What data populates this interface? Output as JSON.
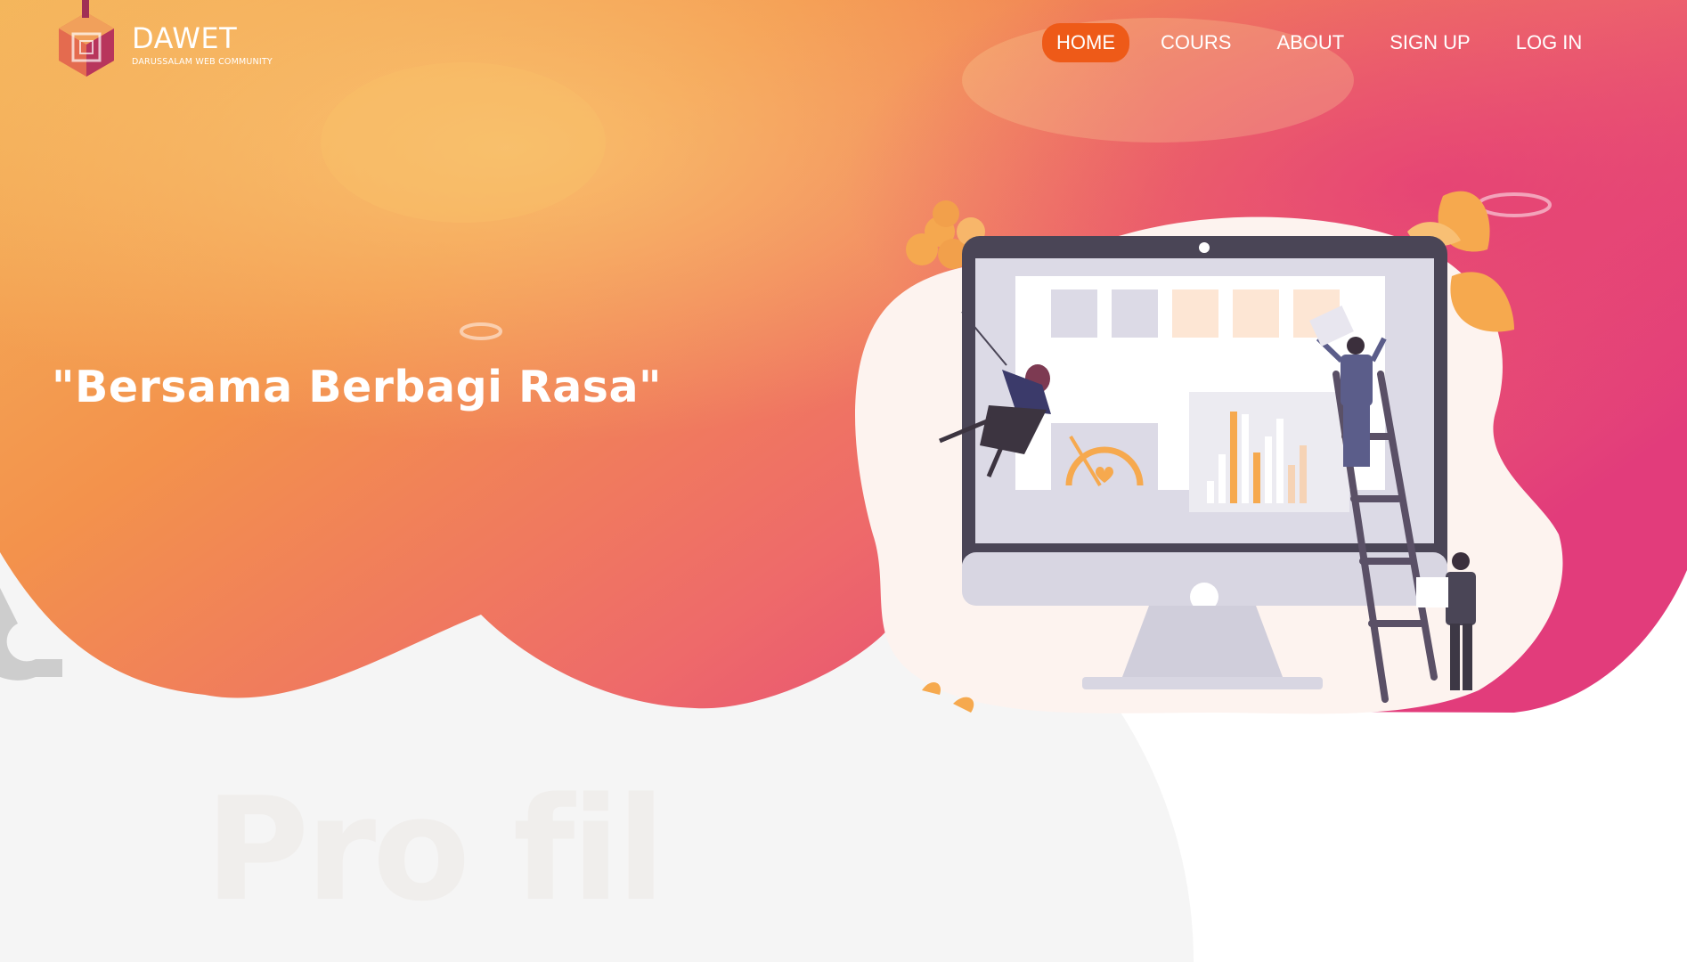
{
  "brand": {
    "name": "DAWET",
    "subtitle": "DARUSSALAM WEB COMMUNITY"
  },
  "nav": {
    "items": [
      {
        "label": "HOME",
        "active": true
      },
      {
        "label": "COURS",
        "active": false
      },
      {
        "label": "ABOUT",
        "active": false
      },
      {
        "label": "SIGN UP",
        "active": false
      },
      {
        "label": "LOG IN",
        "active": false
      }
    ]
  },
  "hero": {
    "tagline": "\"Bersama Berbagi Rasa\""
  },
  "colors": {
    "nav_active": "#ee5a18",
    "hero_orange": "#f3924c",
    "hero_pink": "#e23c7b",
    "hero_yellow": "#f4b45a",
    "section_bg": "#f5f5f5"
  },
  "icons": {
    "logo": "hexagon-cube-logo",
    "illustration": "people-working-on-monitor-dashboard"
  }
}
